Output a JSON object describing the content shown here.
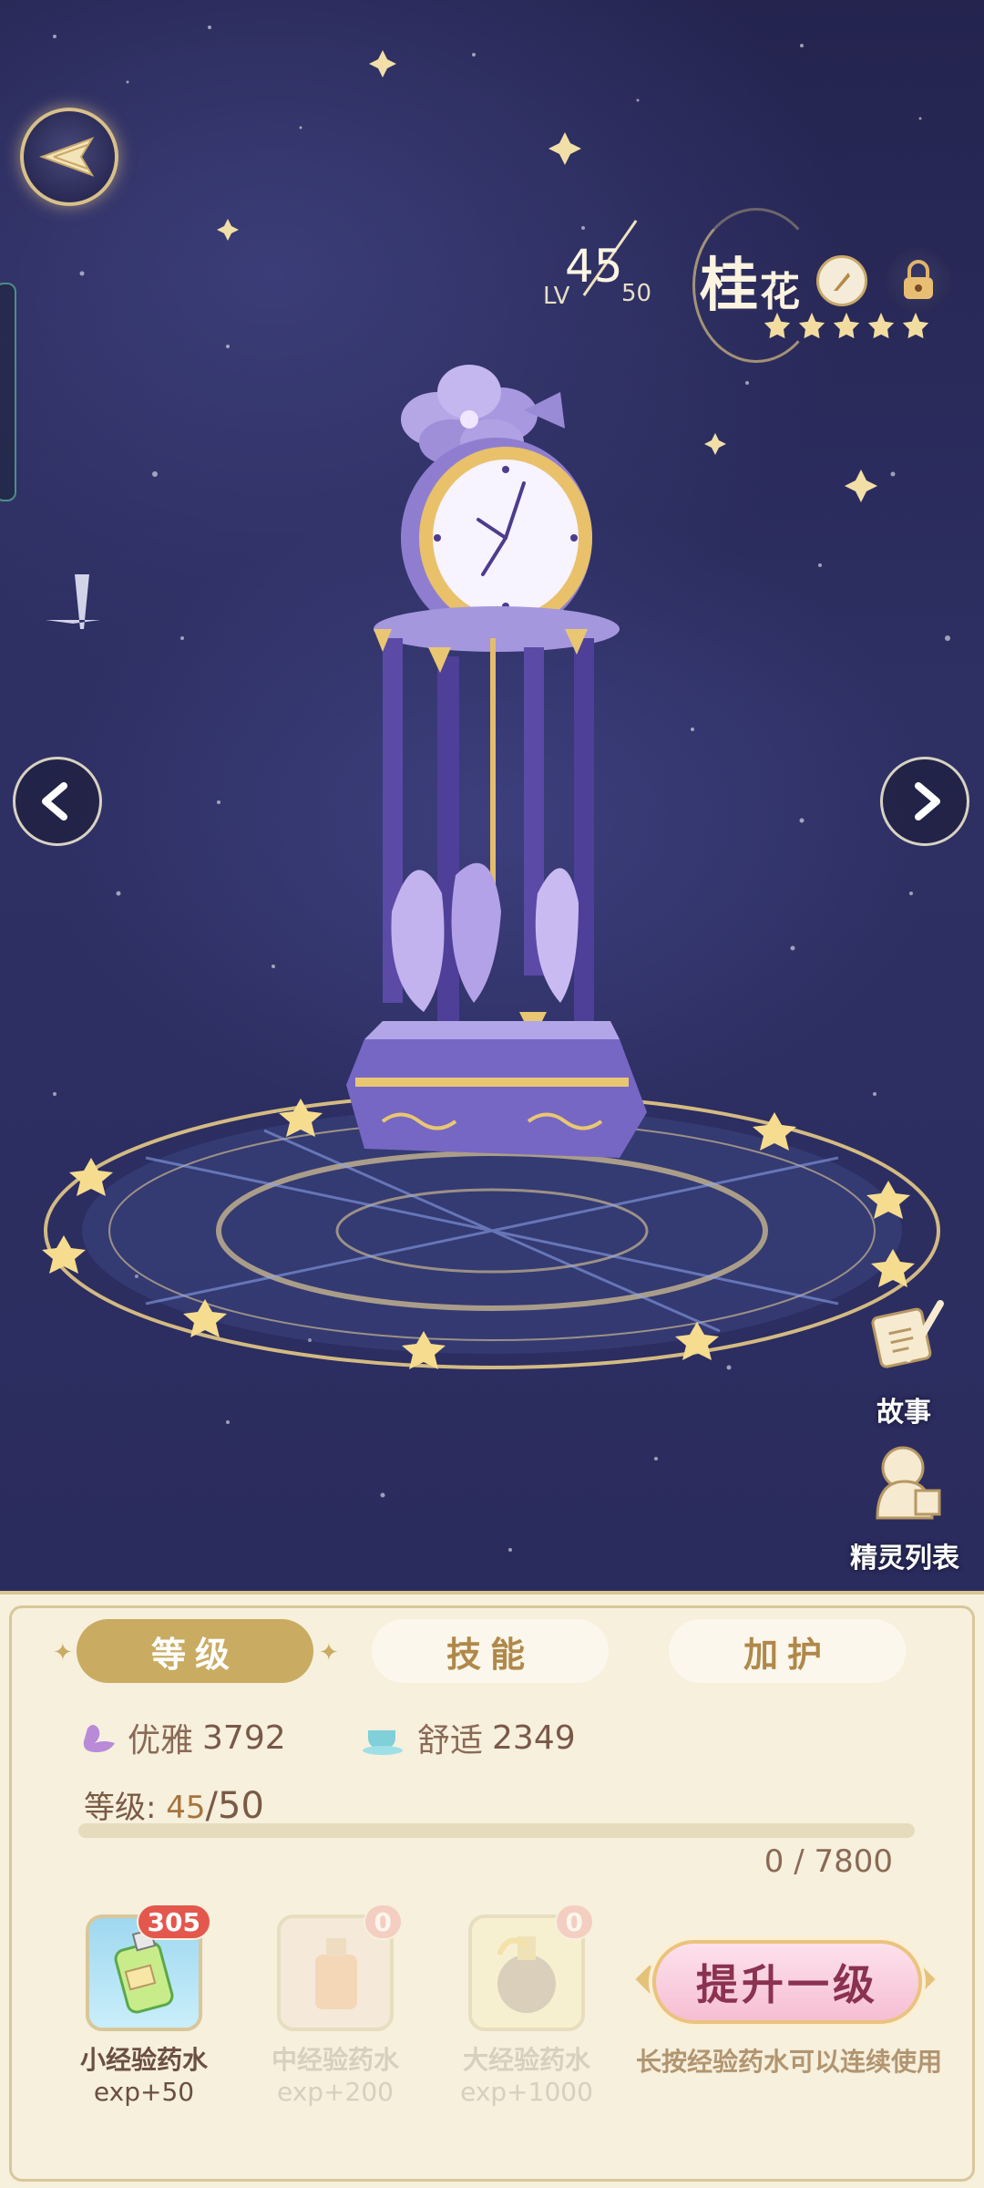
{
  "header": {
    "level_label": "LV",
    "level_current": "45",
    "level_max": "50",
    "pet_name_main": "桂",
    "pet_name_rest": "花",
    "star_rating": 5
  },
  "side_actions": {
    "story_label": "故事",
    "spirits_label": "精灵列表"
  },
  "tabs": [
    {
      "label": "等级"
    },
    {
      "label": "技能"
    },
    {
      "label": "加护"
    }
  ],
  "stats": {
    "elegant_label": "优雅",
    "elegant_value": "3792",
    "comfort_label": "舒适",
    "comfort_value": "2349"
  },
  "level_info": {
    "label": "等级: ",
    "current": "45",
    "sep": "/",
    "max": "50",
    "exp_text": "0 / 7800",
    "exp_progress": 0
  },
  "potions": [
    {
      "name": "小经验药水",
      "exp": "exp+50",
      "count": "305"
    },
    {
      "name": "中经验药水",
      "exp": "exp+200",
      "count": "0"
    },
    {
      "name": "大经验药水",
      "exp": "exp+1000",
      "count": "0"
    }
  ],
  "upgrade": {
    "label": "提升一级",
    "hint": "长按经验药水可以连续使用"
  },
  "colors": {
    "accent_gold": "#c9ab62",
    "badge_red": "#e4574d",
    "upgrade_pink": "#f6bfd3",
    "panel_bg": "#f6f0dd"
  }
}
